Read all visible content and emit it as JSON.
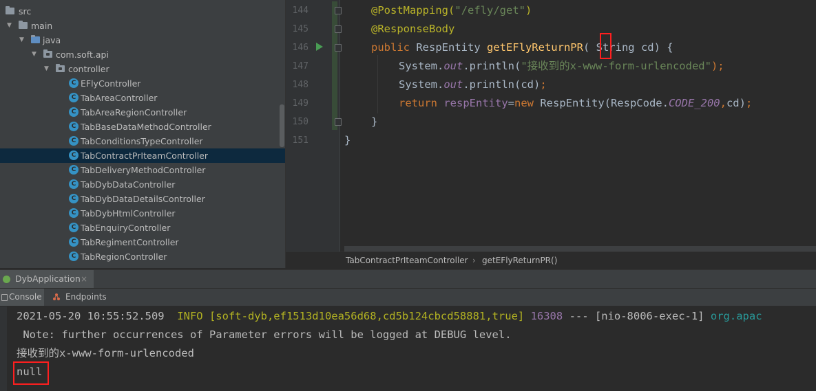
{
  "project_tree": {
    "items": [
      {
        "label": "src",
        "type": "folder",
        "level": 0
      },
      {
        "label": "main",
        "type": "folder",
        "level": 1,
        "expanded": true
      },
      {
        "label": "java",
        "type": "folder",
        "level": 2,
        "expanded": true
      },
      {
        "label": "com.soft.api",
        "type": "package",
        "level": 3,
        "expanded": true
      },
      {
        "label": "controller",
        "type": "package",
        "level": 4,
        "expanded": true
      },
      {
        "label": "EFlyController",
        "type": "class",
        "level": 5
      },
      {
        "label": "TabAreaController",
        "type": "class",
        "level": 5
      },
      {
        "label": "TabAreaRegionController",
        "type": "class",
        "level": 5
      },
      {
        "label": "TabBaseDataMethodController",
        "type": "class",
        "level": 5
      },
      {
        "label": "TabConditionsTypeController",
        "type": "class",
        "level": 5
      },
      {
        "label": "TabContractPrIteamController",
        "type": "class",
        "level": 5,
        "selected": true
      },
      {
        "label": "TabDeliveryMethodController",
        "type": "class",
        "level": 5
      },
      {
        "label": "TabDybDataController",
        "type": "class",
        "level": 5
      },
      {
        "label": "TabDybDataDetailsController",
        "type": "class",
        "level": 5
      },
      {
        "label": "TabDybHtmlController",
        "type": "class",
        "level": 5
      },
      {
        "label": "TabEnquiryController",
        "type": "class",
        "level": 5
      },
      {
        "label": "TabRegimentController",
        "type": "class",
        "level": 5
      },
      {
        "label": "TabRegionController",
        "type": "class",
        "level": 5
      }
    ],
    "class_icon_letter": "C"
  },
  "editor": {
    "line_numbers": [
      "144",
      "145",
      "146",
      "147",
      "148",
      "149",
      "150",
      "151"
    ],
    "lines": {
      "l144_ann": "@PostMapping(",
      "l144_str": "\"/efly/get\"",
      "l144_end": ")",
      "l145_ann": "@ResponseBody",
      "l146_kw": "public ",
      "l146_type": "RespEntity ",
      "l146_fn": "getEFlyReturnPR",
      "l146_rest": "( String cd) {",
      "l147_a": "System.",
      "l147_out": "out",
      "l147_b": ".println(",
      "l147_str": "\"接收到的x-www-form-urlencoded\"",
      "l147_end": ");",
      "l148_a": "System.",
      "l148_out": "out",
      "l148_b": ".println(cd)",
      "l148_semi": ";",
      "l149_kw": "return ",
      "l149_var": "respEntity",
      "l149_eq": "=",
      "l149_new": "new ",
      "l149_type": "RespEntity(RespCode.",
      "l149_const": "CODE_200",
      "l149_c": ",",
      "l149_cd": "cd)",
      "l149_semi": ";",
      "l150": "}",
      "l151": "}"
    }
  },
  "breadcrumb": {
    "class_name": "TabContractPrIteamController",
    "separator": "›",
    "method_name": "getEFlyReturnPR()"
  },
  "run_window": {
    "tab_label": "DybApplication",
    "close_glyph": "×",
    "sub_tabs": [
      "Console",
      "Endpoints"
    ]
  },
  "console": {
    "line1_ts": "2021-05-20 10:55:52.509  ",
    "line1_info": "INFO ",
    "line1_ctx": "[soft-dyb,ef1513d10ea56d68,cd5b124cbcd58881,true] ",
    "line1_pid": "16308",
    "line1_thread": " --- [nio-8006-exec-1] ",
    "line1_cls": "org.apac",
    "line2": " Note: further occurrences of Parameter errors will be logged at DEBUG level.",
    "line3": "接收到的x-www-form-urlencoded",
    "line4": "null"
  },
  "colors": {
    "highlight_box": "#ff1f1f",
    "selection": "#0d293e"
  }
}
